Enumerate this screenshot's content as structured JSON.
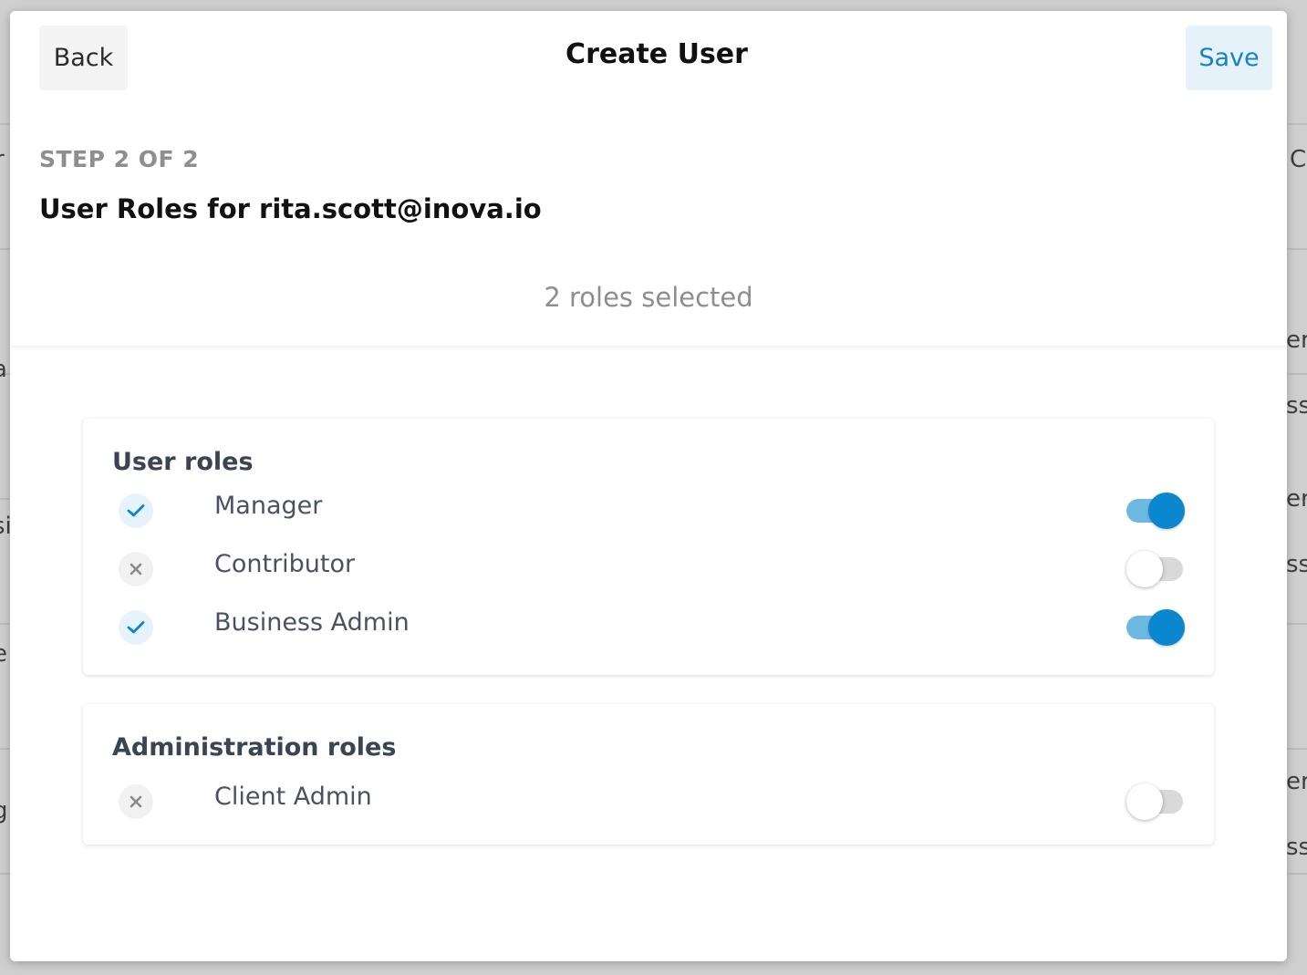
{
  "background": {
    "fragments": [
      "r",
      "C",
      "a",
      "er",
      "ss",
      "si",
      "er",
      "ss",
      "e",
      "g",
      "er",
      "ss"
    ]
  },
  "header": {
    "back_label": "Back",
    "title": "Create User",
    "save_label": "Save",
    "step_label": "STEP 2 OF 2",
    "roles_heading": "User Roles for rita.scott@inova.io",
    "selected_count": "2 roles selected"
  },
  "user_roles": {
    "title": "User roles",
    "items": [
      {
        "label": "Manager",
        "enabled": true
      },
      {
        "label": "Contributor",
        "enabled": false
      },
      {
        "label": "Business Admin",
        "enabled": true
      }
    ]
  },
  "admin_roles": {
    "title": "Administration roles",
    "items": [
      {
        "label": "Client Admin",
        "enabled": false
      }
    ]
  },
  "colors": {
    "accent": "#0a87cf",
    "accent_light": "#6db9e3",
    "save_text": "#1584c4",
    "muted_text": "#8e8e8e"
  },
  "icons": {
    "enabled": "check-icon",
    "disabled": "x-icon"
  }
}
